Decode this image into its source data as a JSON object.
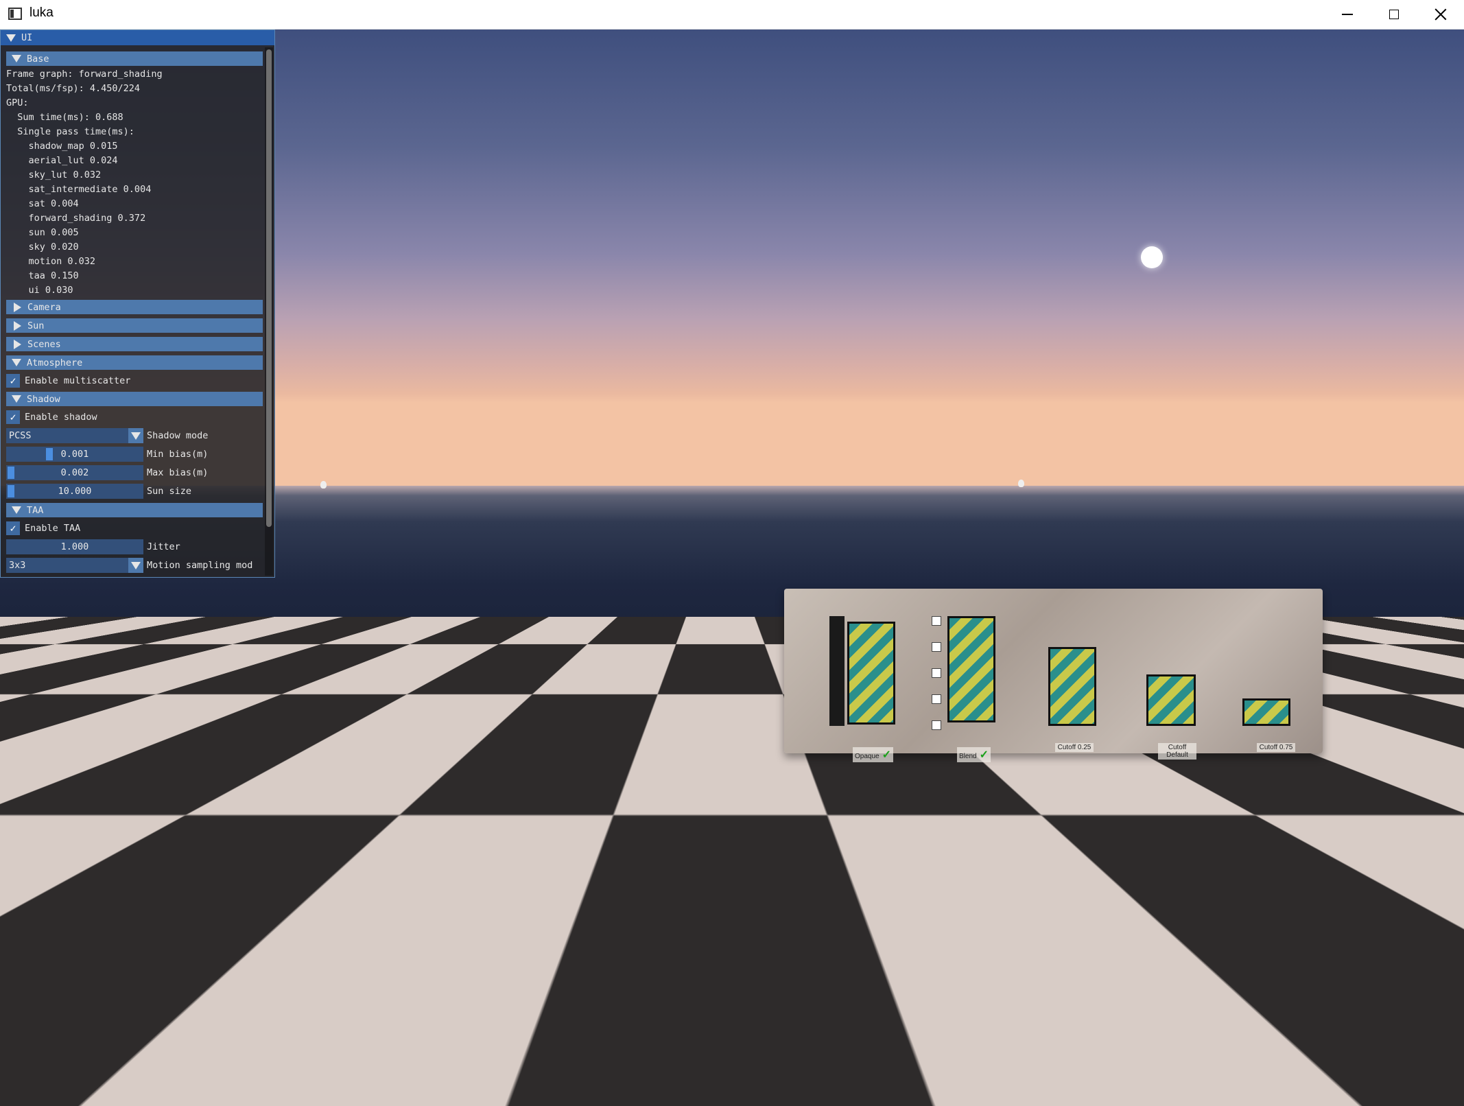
{
  "window": {
    "title": "luka"
  },
  "ui": {
    "title": "UI",
    "base": {
      "header": "Base",
      "lines": [
        "Frame graph: forward_shading",
        "Total(ms/fsp): 4.450/224",
        "GPU:",
        "  Sum time(ms): 0.688",
        "  Single pass time(ms):",
        "    shadow_map 0.015",
        "    aerial_lut 0.024",
        "    sky_lut 0.032",
        "    sat_intermediate 0.004",
        "    sat 0.004",
        "    forward_shading 0.372",
        "    sun 0.005",
        "    sky 0.020",
        "    motion 0.032",
        "    taa 0.150",
        "    ui 0.030"
      ]
    },
    "camera": {
      "header": "Camera"
    },
    "sun": {
      "header": "Sun"
    },
    "scenes": {
      "header": "Scenes"
    },
    "atmosphere": {
      "header": "Atmosphere",
      "multiscatter_label": "Enable multiscatter",
      "multiscatter_checked": true
    },
    "shadow": {
      "header": "Shadow",
      "enable_label": "Enable shadow",
      "enable_checked": true,
      "mode_value": "PCSS",
      "mode_label": "Shadow mode",
      "min_bias_value": "0.001",
      "min_bias_label": "Min bias(m)",
      "min_bias_fraction": 0.3,
      "max_bias_value": "0.002",
      "max_bias_label": "Max bias(m)",
      "max_bias_fraction": 0.0,
      "sun_size_value": "10.000",
      "sun_size_label": "Sun size",
      "sun_size_fraction": 0.0
    },
    "taa": {
      "header": "TAA",
      "enable_label": "Enable TAA",
      "enable_checked": true,
      "jitter_value": "1.000",
      "jitter_label": "Jitter",
      "motion_mode_value": "3x3",
      "motion_mode_label": "Motion sampling mod"
    }
  },
  "scene": {
    "board_labels": {
      "opaque": "Opaque",
      "blend": "Blend",
      "cutoff_025": "Cutoff 0.25",
      "cutoff_default": "Cutoff Default",
      "cutoff_075": "Cutoff 0.75"
    }
  },
  "colors": {
    "panel_bg": "#242428",
    "header_bg": "#4e79ac",
    "title_bg": "#295da8",
    "widget_bg": "#33507a",
    "slider_grab": "#4b8ee0"
  }
}
